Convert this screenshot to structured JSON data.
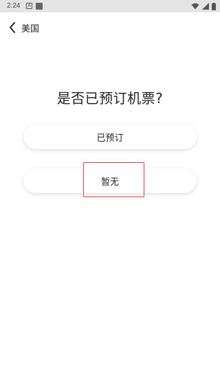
{
  "status_bar": {
    "time": "2:24",
    "left_icons": [
      "a-notification-icon",
      "square-notification-icon"
    ],
    "right_icons": [
      "wifi-icon",
      "signal-icon",
      "battery-icon"
    ]
  },
  "header": {
    "back_icon": "chevron-left-icon",
    "title": "美国"
  },
  "main": {
    "question": "是否已预订机票?",
    "options": [
      {
        "label": "已预订"
      },
      {
        "label": "暂无"
      }
    ]
  },
  "colors": {
    "background": "#ffffff",
    "status_bar": "#e4e4e4",
    "text": "#222222",
    "highlight": "#e53935"
  }
}
